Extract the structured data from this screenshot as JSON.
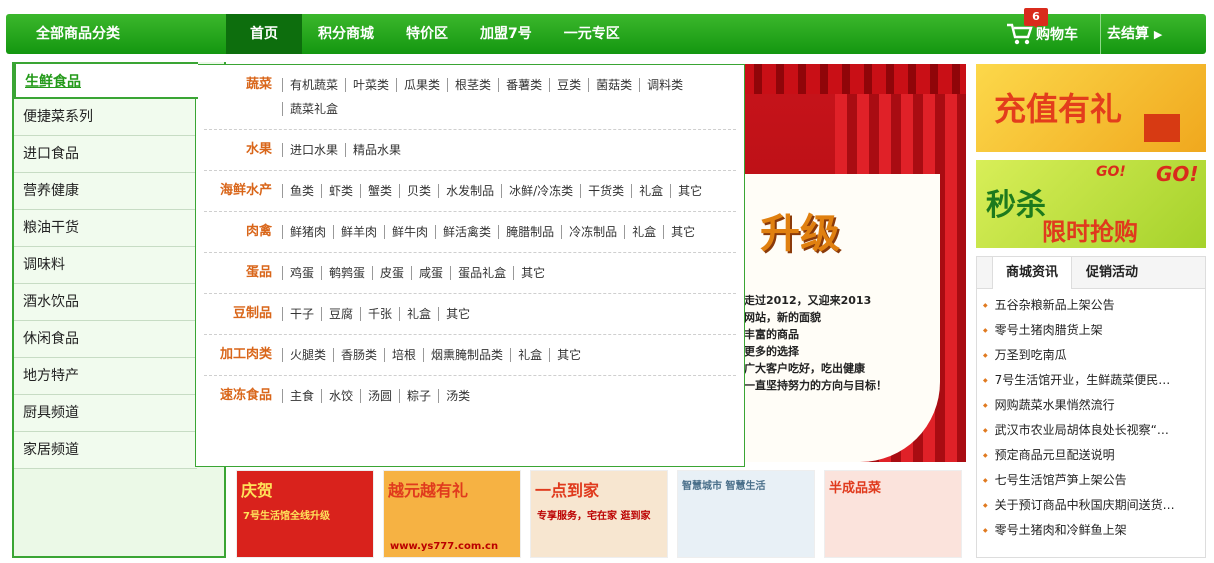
{
  "header": {
    "all_categories_label": "全部商品分类",
    "nav_items": [
      "首页",
      "积分商城",
      "特价区",
      "加盟7号",
      "一元专区"
    ],
    "cart_label": "购物车",
    "cart_count": "6",
    "checkout_label": "去结算",
    "checkout_arrow": "▶",
    "accent": "#1fa51a"
  },
  "categories": [
    "生鲜食品",
    "便捷菜系列",
    "进口食品",
    "营养健康",
    "粮油干货",
    "调味料",
    "酒水饮品",
    "休闲食品",
    "地方特产",
    "厨具频道",
    "家居频道"
  ],
  "dropdown": [
    {
      "name": "蔬菜",
      "links": [
        "有机蔬菜",
        "叶菜类",
        "瓜果类",
        "根茎类",
        "番薯类",
        "豆类",
        "菌菇类",
        "调料类",
        "蔬菜礼盒"
      ]
    },
    {
      "name": "水果",
      "links": [
        "进口水果",
        "精品水果"
      ]
    },
    {
      "name": "海鲜水产",
      "links": [
        "鱼类",
        "虾类",
        "蟹类",
        "贝类",
        "水发制品",
        "冰鲜/冷冻类",
        "干货类",
        "礼盒",
        "其它"
      ]
    },
    {
      "name": "肉禽",
      "links": [
        "鲜猪肉",
        "鲜羊肉",
        "鲜牛肉",
        "鲜活禽类",
        "腌腊制品",
        "冷冻制品",
        "礼盒",
        "其它"
      ]
    },
    {
      "name": "蛋品",
      "links": [
        "鸡蛋",
        "鹌鹑蛋",
        "皮蛋",
        "咸蛋",
        "蛋品礼盒",
        "其它"
      ]
    },
    {
      "name": "豆制品",
      "links": [
        "干子",
        "豆腐",
        "千张",
        "礼盒",
        "其它"
      ]
    },
    {
      "name": "加工肉类",
      "links": [
        "火腿类",
        "香肠类",
        "培根",
        "烟熏腌制品类",
        "礼盒",
        "其它"
      ]
    },
    {
      "name": "速冻食品",
      "links": [
        "主食",
        "水饺",
        "汤圆",
        "粽子",
        "汤类"
      ]
    }
  ],
  "banner": {
    "title": "升级",
    "lines": [
      "走过2012，又迎来2013",
      "网站，新的面貌",
      "丰富的商品",
      "更多的选择",
      "广大客户吃好，吃出健康",
      "一直坚持努力的方向与目标！"
    ]
  },
  "ads": {
    "recharge": "充值有礼",
    "flash_main": "秒杀",
    "flash_sub": "限时抢购",
    "go_text": "GO!"
  },
  "news": {
    "tabs": [
      "商城资讯",
      "促销活动"
    ],
    "items": [
      "五谷杂粮新品上架公告",
      "零号土猪肉腊货上架",
      "万圣到吃南瓜",
      "7号生活馆开业，生鲜蔬菜便民…",
      "网购蔬菜水果悄然流行",
      "武汉市农业局胡体良处长视察“…",
      "预定商品元旦配送说明",
      "七号生活馆芦笋上架公告",
      "关于预订商品中秋国庆期间送货…",
      "零号土猪肉和冷鲜鱼上架"
    ]
  },
  "thumbs": [
    {
      "title": "庆贺",
      "sub": "7号生活馆全线升级",
      "bg": "#d9221c"
    },
    {
      "title": "越元越有礼",
      "sub": "www.ys777.com.cn",
      "bg": "#f6b243"
    },
    {
      "title": "一点到家",
      "sub": "专享服务，宅在家 逛到家",
      "bg": "#f7e6d0"
    },
    {
      "title": "智慧城市 智慧生活",
      "sub": "",
      "bg": "#e8f0f6"
    },
    {
      "title": "半成品菜",
      "sub": "",
      "bg": "#fbe3dc"
    }
  ]
}
